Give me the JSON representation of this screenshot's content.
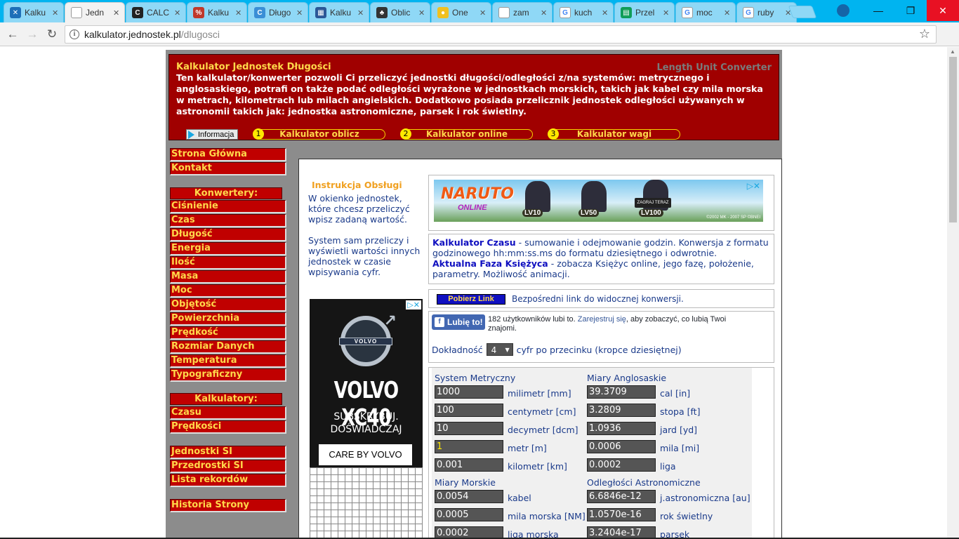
{
  "browser": {
    "tabs": [
      {
        "label": "Kalku",
        "color": "#1e6fb8",
        "glyph": "✕",
        "active": false
      },
      {
        "label": "Jedn",
        "color": "#ffffff",
        "glyph": "",
        "active": true
      },
      {
        "label": "CALC",
        "color": "#222222",
        "glyph": "C",
        "active": false
      },
      {
        "label": "Kalku",
        "color": "#c0392b",
        "glyph": "%",
        "active": false
      },
      {
        "label": "Długo",
        "color": "#3a8fd6",
        "glyph": "C",
        "active": false
      },
      {
        "label": "Kalku",
        "color": "#2b5797",
        "glyph": "▦",
        "active": false
      },
      {
        "label": "Oblic",
        "color": "#333333",
        "glyph": "♣",
        "active": false
      },
      {
        "label": "One",
        "color": "#f0c020",
        "glyph": "●",
        "active": false
      },
      {
        "label": "zam",
        "color": "#ffffff",
        "glyph": "",
        "active": false
      },
      {
        "label": "kuch",
        "color": "#ffffff",
        "glyph": "G",
        "active": false
      },
      {
        "label": "Przel",
        "color": "#0f9d58",
        "glyph": "▤",
        "active": false
      },
      {
        "label": "moc",
        "color": "#ffffff",
        "glyph": "G",
        "active": false
      },
      {
        "label": "ruby",
        "color": "#ffffff",
        "glyph": "G",
        "active": false
      }
    ],
    "url_host": "kalkulator.jednostek.pl",
    "url_path": "/dlugosci",
    "info_glyph": "i"
  },
  "header": {
    "title": "Kalkulator Jednostek Długości",
    "subtitle": "Length Unit Converter",
    "description": "Ten kalkulator/konwerter pozwoli Ci przeliczyć jednostki długości/odległości z/na systemów: metrycznego i anglosaskiego, potrafi on także podać odległości wyrażone w jednostkach morskich, takich jak kabel czy mila morska w metrach, kilometrach lub milach angielskich. Dodatkowo posiada przelicznik jednostek odległości używanych w astronomii takich jak: jednostka astronomiczne, parsek i rok świetlny.",
    "info_button": "Informacja",
    "pills": [
      {
        "num": "1",
        "label": "Kalkulator oblicz"
      },
      {
        "num": "2",
        "label": "Kalkulator online"
      },
      {
        "num": "3",
        "label": "Kalkulator wagi"
      }
    ]
  },
  "sidebar": {
    "top": [
      "Strona Główna",
      "Kontakt"
    ],
    "converters_heading": "Konwertery:",
    "converters": [
      "Ciśnienie",
      "Czas",
      "Długość",
      "Energia",
      "Ilość",
      "Masa",
      "Moc",
      "Objętość",
      "Powierzchnia",
      "Prędkość",
      "Rozmiar Danych",
      "Temperatura",
      "Typograficzny"
    ],
    "calculators_heading": "Kalkulatory:",
    "calculators": [
      "Czasu",
      "Prędkości"
    ],
    "other": [
      "Jednostki SI",
      "Przedrostki SI",
      "Lista rekordów"
    ],
    "history": "Historia Strony"
  },
  "instructions": {
    "title": "Instrukcja Obsługi",
    "p1": "W okienko jednostek, które chcesz przeliczyć wpisz zadaną wartość.",
    "p2": "System sam przeliczy i wyświetli wartości innych jednostek w czasie wpisywania cyfr."
  },
  "ads": {
    "volvo_badge": "VOLVO",
    "volvo_title": "VOLVO XC40",
    "volvo_line1": "SUBSKRYBUJ.",
    "volvo_line2": "DOŚWIADCZAJ",
    "volvo_care": "CARE BY VOLVO",
    "naruto_logo": "NARUTO",
    "naruto_online": "ONLINE",
    "naruto_levels": [
      "LV10",
      "LV50",
      "LV100"
    ],
    "naruto_btn": "ZAGRAJ TERAZ",
    "naruto_copy": "©2002 MK - 2007 SP ©BNEI"
  },
  "links": {
    "czasu_title": "Kalkulator Czasu",
    "czasu_desc": " - sumowanie i odejmowanie godzin. Konwersja z formatu godzinowego hh:mm:ss.ms do formatu dziesiętnego i odwrotnie.",
    "faza_title": "Aktualna Faza Księżyca",
    "faza_desc": " - zobacza Księżyc online, jego fazę, położenie, parametry. Możliwość animacji."
  },
  "pobierz": {
    "button": "Pobierz Link",
    "text": "Bezpośredni link do widocznej konwersji."
  },
  "facebook": {
    "button": "Lubię to!",
    "count_text": "182 użytkowników lubi to. ",
    "register": "Zarejestruj się",
    "rest": ", aby zobaczyć, co lubią Twoi znajomi."
  },
  "precision": {
    "label": "Dokładność",
    "value": "4",
    "suffix": "cyfr po przecinku (kropce dziesiętnej)"
  },
  "converter": {
    "metric_heading": "System Metryczny",
    "anglo_heading": "Miary Anglosaskie",
    "naval_heading": "Miary Morskie",
    "astro_heading": "Odległości Astronomiczne",
    "metric": [
      {
        "value": "1000",
        "unit": "milimetr [mm]"
      },
      {
        "value": "100",
        "unit": "centymetr [cm]"
      },
      {
        "value": "10",
        "unit": "decymetr [dcm]"
      },
      {
        "value": "1",
        "unit": "metr [m]"
      },
      {
        "value": "0.001",
        "unit": "kilometr [km]"
      }
    ],
    "anglo": [
      {
        "value": "39.3709",
        "unit": "cal [in]"
      },
      {
        "value": "3.2809",
        "unit": "stopa [ft]"
      },
      {
        "value": "1.0936",
        "unit": "jard [yd]"
      },
      {
        "value": "0.0006",
        "unit": "mila [mi]"
      },
      {
        "value": "0.0002",
        "unit": "liga"
      }
    ],
    "naval": [
      {
        "value": "0.0054",
        "unit": "kabel"
      },
      {
        "value": "0.0005",
        "unit": "mila morska [NM]"
      },
      {
        "value": "0.0002",
        "unit": "liga morska"
      }
    ],
    "astro": [
      {
        "value": "6.6846e-12",
        "unit": "j.astronomiczna [au]"
      },
      {
        "value": "1.0570e-16",
        "unit": "rok świetlny"
      },
      {
        "value": "3.2404e-17",
        "unit": "parsek"
      }
    ]
  }
}
